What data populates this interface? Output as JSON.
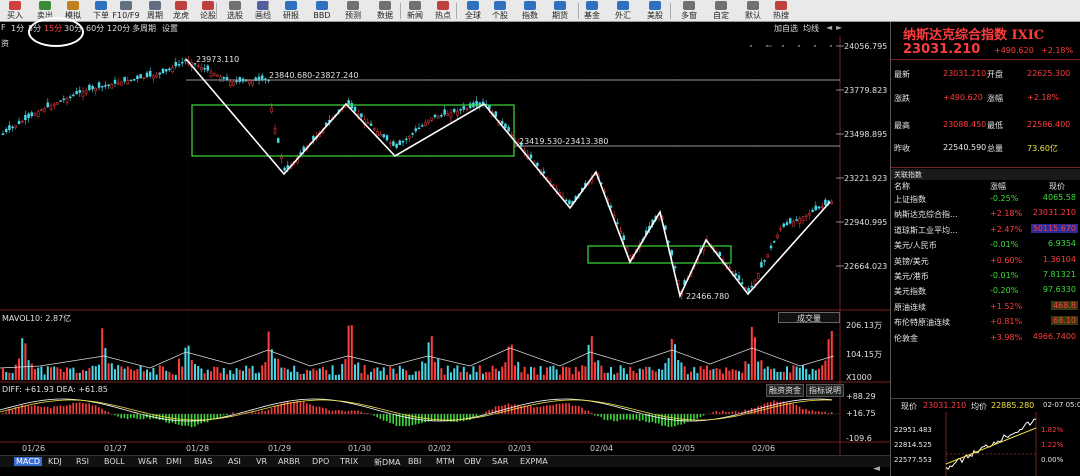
{
  "toolbar": {
    "items": [
      {
        "label": "买入",
        "icon": "buy-icon",
        "color": "#d04040"
      },
      {
        "label": "卖出",
        "icon": "sell-icon",
        "color": "#3a8a3a"
      },
      {
        "label": "模拟",
        "icon": "simulate-icon",
        "color": "#c08020"
      },
      {
        "label": "下单",
        "icon": "order-icon",
        "color": "#3070c0"
      },
      {
        "label": "F10/F9",
        "icon": "f10-icon",
        "color": "#607080"
      },
      {
        "label": "周期",
        "icon": "period-icon",
        "color": "#607080"
      },
      {
        "label": "龙虎",
        "icon": "dragon-tiger-icon",
        "color": "#c04040"
      },
      {
        "label": "论股",
        "icon": "discuss-icon",
        "color": "#c04040"
      },
      {
        "label": "选股",
        "icon": "stock-picker-icon",
        "color": "#707070"
      },
      {
        "label": "画线",
        "icon": "draw-line-icon",
        "color": "#5060a0"
      },
      {
        "label": "研报",
        "icon": "research-icon",
        "color": "#3070c0"
      },
      {
        "label": "BBD",
        "icon": "bbd-icon",
        "color": "#3070c0"
      },
      {
        "label": "预测",
        "icon": "forecast-icon",
        "color": "#707070"
      },
      {
        "label": "数据",
        "icon": "data-icon",
        "color": "#707070"
      },
      {
        "label": "新闻",
        "icon": "news-icon",
        "color": "#707070"
      },
      {
        "label": "热点",
        "icon": "hotspot-icon",
        "color": "#c04040"
      },
      {
        "label": "全球",
        "icon": "globe-icon",
        "color": "#3070c0"
      },
      {
        "label": "个股",
        "icon": "stock-icon",
        "color": "#3070c0"
      },
      {
        "label": "指数",
        "icon": "index-icon",
        "color": "#3070c0"
      },
      {
        "label": "期货",
        "icon": "futures-icon",
        "color": "#3070c0"
      },
      {
        "label": "基金",
        "icon": "fund-icon",
        "color": "#3070c0"
      },
      {
        "label": "外汇",
        "icon": "forex-icon",
        "color": "#3070c0"
      },
      {
        "label": "美股",
        "icon": "us-stock-icon",
        "color": "#3070c0"
      },
      {
        "label": "多窗",
        "icon": "multi-window-icon",
        "color": "#707070"
      },
      {
        "label": "自定",
        "icon": "custom-icon",
        "color": "#707070"
      },
      {
        "label": "默认",
        "icon": "default-icon",
        "color": "#707070"
      },
      {
        "label": "热搜",
        "icon": "hot-search-icon",
        "color": "#c04040"
      }
    ]
  },
  "periods": {
    "items": [
      "1分",
      "5分",
      "15分",
      "30分",
      "60分",
      "120分",
      "多周期",
      "设置"
    ],
    "active": "15分"
  },
  "chart_tools": {
    "stack": "加自选",
    "avg": "均线",
    "prev": "◄",
    "next": "►"
  },
  "main_chart": {
    "prices": [
      "24056.795",
      "23779.823",
      "23498.895",
      "23221.923",
      "22940.995",
      "22664.023"
    ],
    "labels": {
      "high": "23973.110",
      "resist": "23840.680-23827.240",
      "support": "23419.530-23413.380",
      "low": "22466.780"
    },
    "left_mark": "资"
  },
  "volume_panel": {
    "title": "MAVOL10: 2.87亿",
    "dropdown": "成交量",
    "scale": [
      "206.13万",
      "104.15万",
      "X1000"
    ]
  },
  "macd_panel": {
    "title": "DIFF: +61.93  DEA: +61.85",
    "buttons": [
      "融资资金",
      "指标说明"
    ],
    "scale": [
      "+88.29",
      "+16.75",
      "-109.6"
    ]
  },
  "dates": [
    "01/26",
    "01/27",
    "01/28",
    "01/29",
    "01/30",
    "02/02",
    "02/03",
    "02/04",
    "02/05",
    "02/06"
  ],
  "bottom_tabs": {
    "items": [
      "MACD",
      "KDJ",
      "RSI",
      "BOLL",
      "W&R",
      "DMI",
      "BIAS",
      "ASI",
      "VR",
      "ARBR",
      "DPO",
      "TRIX",
      "新DMA",
      "BBI",
      "MTM",
      "OBV",
      "SAR",
      "EXPMA"
    ],
    "active": "MACD"
  },
  "quote": {
    "title": "纳斯达克综合指数 IXIC",
    "price": "23031.210",
    "change": "+490.620",
    "pct": "+2.18%",
    "rows": [
      {
        "l1": "最新",
        "v1": "23031.210",
        "l2": "开盘",
        "v2": "22625.300"
      },
      {
        "l1": "涨跌",
        "v1": "+490.620",
        "l2": "涨幅",
        "v2": "+2.18%"
      },
      {
        "l1": "最高",
        "v1": "23088.450",
        "l2": "最低",
        "v2": "22586.400"
      },
      {
        "l1": "昨收",
        "v1": "22540.590",
        "l2": "总量",
        "v2": "73.60亿"
      }
    ]
  },
  "related": {
    "title": "关联指数",
    "headers": [
      "名称",
      "涨幅",
      "现价"
    ],
    "rows": [
      {
        "name": "上证指数",
        "pct": "-0.25%",
        "price": "4065.58",
        "dir": "down"
      },
      {
        "name": "纳斯达克综合指...",
        "pct": "+2.18%",
        "price": "23031.210",
        "dir": "up"
      },
      {
        "name": "道琼斯工业平均...",
        "pct": "+2.47%",
        "price": "50115.670",
        "dir": "up"
      },
      {
        "name": "美元/人民币",
        "pct": "-0.01%",
        "price": "6.9354",
        "dir": "down"
      },
      {
        "name": "英镑/美元",
        "pct": "+0.60%",
        "price": "1.36104",
        "dir": "up"
      },
      {
        "name": "美元/港币",
        "pct": "-0.01%",
        "price": "7.81321",
        "dir": "down"
      },
      {
        "name": "美元指数",
        "pct": "-0.20%",
        "price": "97.6330",
        "dir": "down"
      },
      {
        "name": "原油连续",
        "pct": "+1.52%",
        "price": "468.8",
        "dir": "up"
      },
      {
        "name": "布伦特原油连续",
        "pct": "+0.81%",
        "price": "68.10",
        "dir": "up"
      },
      {
        "name": "伦敦金",
        "pct": "+3.98%",
        "price": "4966.7400",
        "dir": "up"
      }
    ]
  },
  "mini_chart": {
    "header_now": "现价",
    "header_now_val": "23031.210",
    "header_avg": "均价",
    "header_avg_val": "22885.280",
    "header_time": "02-07 05:00",
    "prices": [
      "22951.483",
      "22814.525",
      "22577.553"
    ],
    "pcts": [
      "1.82%",
      "1.22%",
      "0.00%"
    ]
  }
}
